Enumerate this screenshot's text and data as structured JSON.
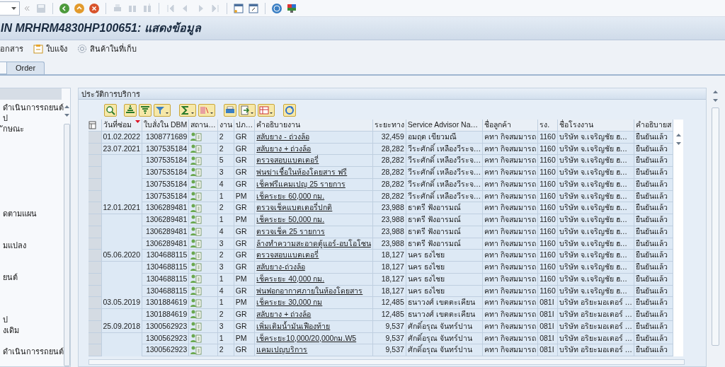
{
  "title": "IN MRHRM4830HP100651: แสดงข้อมูล",
  "app_toolbar": [
    {
      "label": "อกสาร",
      "kind": "plain"
    },
    {
      "label": "ใบแจ้ง",
      "kind": "notice"
    },
    {
      "label": "สินค้าในที่เก็บ",
      "kind": "stock"
    }
  ],
  "tabs": [
    {
      "label": "Order",
      "selected": false
    }
  ],
  "sidebar": {
    "items": [
      {
        "label": "ดำเนินการรถยนต์"
      },
      {
        "label": "ป"
      },
      {
        "label": "ักษณะ"
      },
      {
        "label": "ดตามแผน"
      },
      {
        "label": "มแปลง"
      },
      {
        "label": "ยนต์"
      },
      {
        "label": "ป"
      },
      {
        "label": "งเดิม"
      },
      {
        "label": "ดำเนินการรถยนต์"
      }
    ]
  },
  "panel": {
    "title": "ประวัติการบริการ",
    "table": {
      "columns": [
        "วันที่ซ่อม",
        "ใบสั่งใน DBM",
        "สถาน…",
        "งาน",
        "ปภ…",
        "คำอธิบายงาน",
        "ระยะทาง",
        "Service Advisor Na…",
        "ชื่อลูกค้า",
        "รง.",
        "ชื่อโรงงาน",
        "คำอธิบายส"
      ],
      "rows": [
        {
          "date": "01.02.2022",
          "order": "1308771689",
          "task": "2",
          "type": "GR",
          "description": "สลับยาง - ถ่วงล้อ",
          "distance": "32,459",
          "advisor": "อมฤต เขียวมณี",
          "customer": "คทา กิจสมมารถ",
          "plant": "1160",
          "plant_name": "บริษัท จ.เจริญชัย ฮ…",
          "state": "ยืนยันแล้ว"
        },
        {
          "date": "23.07.2021",
          "order": "1307535184",
          "task": "2",
          "type": "GR",
          "description": "สลับยาง + ถ่วงล้อ",
          "distance": "28,282",
          "advisor": "วีระศักดิ์ เหลืองวีระจ…",
          "customer": "คทา กิจสมมารถ",
          "plant": "1160",
          "plant_name": "บริษัท จ.เจริญชัย ฮ…",
          "state": "ยืนยันแล้ว"
        },
        {
          "order": "1307535184",
          "task": "5",
          "type": "GR",
          "description": "ตรวจสอบแบตเตอรี่",
          "distance": "28,282",
          "advisor": "วีระศักดิ์ เหลืองวีระจ…",
          "customer": "คทา กิจสมมารถ",
          "plant": "1160",
          "plant_name": "บริษัท จ.เจริญชัย ฮ…",
          "state": "ยืนยันแล้ว"
        },
        {
          "order": "1307535184",
          "task": "3",
          "type": "GR",
          "description": "พ่นฆ่าเชื้อในห้องโดยสาร ฟรี",
          "distance": "28,282",
          "advisor": "วีระศักดิ์ เหลืองวีระจ…",
          "customer": "คทา กิจสมมารถ",
          "plant": "1160",
          "plant_name": "บริษัท จ.เจริญชัย ฮ…",
          "state": "ยืนยันแล้ว"
        },
        {
          "order": "1307535184",
          "task": "4",
          "type": "GR",
          "description": "เช็คฟรีแคมเปญ 25 รายการ",
          "distance": "28,282",
          "advisor": "วีระศักดิ์ เหลืองวีระจ…",
          "customer": "คทา กิจสมมารถ",
          "plant": "1160",
          "plant_name": "บริษัท จ.เจริญชัย ฮ…",
          "state": "ยืนยันแล้ว"
        },
        {
          "order": "1307535184",
          "task": "1",
          "type": "PM",
          "description": "เช็คระยะ 60,000 กม.",
          "distance": "28,282",
          "advisor": "วีระศักดิ์ เหลืองวีระจ…",
          "customer": "คทา กิจสมมารถ",
          "plant": "1160",
          "plant_name": "บริษัท จ.เจริญชัย ฮ…",
          "state": "ยืนยันแล้ว"
        },
        {
          "date": "12.01.2021",
          "order": "1306289481",
          "task": "2",
          "type": "GR",
          "description": "ตรวจเช็คแบตเตอรี่ปกติ",
          "distance": "23,988",
          "advisor": "ธาตรี ฟังอารมณ์",
          "customer": "คทา กิจสมมารถ",
          "plant": "1160",
          "plant_name": "บริษัท จ.เจริญชัย ฮ…",
          "state": "ยืนยันแล้ว"
        },
        {
          "order": "1306289481",
          "task": "1",
          "type": "PM",
          "description": "เช็คระยะ 50,000 กม.",
          "distance": "23,988",
          "advisor": "ธาตรี ฟังอารมณ์",
          "customer": "คทา กิจสมมารถ",
          "plant": "1160",
          "plant_name": "บริษัท จ.เจริญชัย ฮ…",
          "state": "ยืนยันแล้ว"
        },
        {
          "order": "1306289481",
          "task": "4",
          "type": "GR",
          "description": "ตรวจเช็ค 25 รายการ",
          "distance": "23,988",
          "advisor": "ธาตรี ฟังอารมณ์",
          "customer": "คทา กิจสมมารถ",
          "plant": "1160",
          "plant_name": "บริษัท จ.เจริญชัย ฮ…",
          "state": "ยืนยันแล้ว"
        },
        {
          "order": "1306289481",
          "task": "3",
          "type": "GR",
          "description": "ล้างทำความสะอาดตู้แอร์-อบโอโซน",
          "distance": "23,988",
          "advisor": "ธาตรี ฟังอารมณ์",
          "customer": "คทา กิจสมมารถ",
          "plant": "1160",
          "plant_name": "บริษัท จ.เจริญชัย ฮ…",
          "state": "ยืนยันแล้ว"
        },
        {
          "date": "05.06.2020",
          "order": "1304688115",
          "task": "2",
          "type": "GR",
          "description": "ตรวจสอบแบตเตอรี่",
          "distance": "18,127",
          "advisor": "นคร ธงไชย",
          "customer": "คทา กิจสมมารถ",
          "plant": "1160",
          "plant_name": "บริษัท จ.เจริญชัย ฮ…",
          "state": "ยืนยันแล้ว"
        },
        {
          "order": "1304688115",
          "task": "3",
          "type": "GR",
          "description": "สลับยาง-ถ่วงล้อ",
          "distance": "18,127",
          "advisor": "นคร ธงไชย",
          "customer": "คทา กิจสมมารถ",
          "plant": "1160",
          "plant_name": "บริษัท จ.เจริญชัย ฮ…",
          "state": "ยืนยันแล้ว"
        },
        {
          "order": "1304688115",
          "task": "1",
          "type": "PM",
          "description": "เช็คระยะ 40,000 กม.",
          "distance": "18,127",
          "advisor": "นคร ธงไชย",
          "customer": "คทา กิจสมมารถ",
          "plant": "1160",
          "plant_name": "บริษัท จ.เจริญชัย ฮ…",
          "state": "ยืนยันแล้ว"
        },
        {
          "order": "1304688115",
          "task": "4",
          "type": "GR",
          "description": "พ่นฟอกอากาศภายในห้องโดยสาร",
          "distance": "18,127",
          "advisor": "นคร ธงไชย",
          "customer": "คทา กิจสมมารถ",
          "plant": "1160",
          "plant_name": "บริษัท จ.เจริญชัย ฮ…",
          "state": "ยืนยันแล้ว"
        },
        {
          "date": "03.05.2019",
          "order": "1301884619",
          "task": "1",
          "type": "PM",
          "description": "เช็คระยะ 30,000 กม",
          "distance": "12,485",
          "advisor": "ธนาวงศ์ เขตตะเคียน",
          "customer": "คทา กิจสมมารถ",
          "plant": "081I",
          "plant_name": "บริษัท อริยะมอเตอร์ …",
          "state": "ยืนยันแล้ว"
        },
        {
          "order": "1301884619",
          "task": "2",
          "type": "GR",
          "description": "สลับยาง + ถ่วงล้อ",
          "distance": "12,485",
          "advisor": "ธนาวงศ์ เขตตะเคียน",
          "customer": "คทา กิจสมมารถ",
          "plant": "081I",
          "plant_name": "บริษัท อริยะมอเตอร์ …",
          "state": "ยืนยันแล้ว"
        },
        {
          "date": "25.09.2018",
          "order": "1300562923",
          "task": "3",
          "type": "GR",
          "description": "เพิ่มเติมน้ำมันเฟืองท้าย",
          "distance": "9,537",
          "advisor": "ศักดิ์อรุณ จันทร์ปาน",
          "customer": "คทา กิจสมมารถ",
          "plant": "081I",
          "plant_name": "บริษัท อริยะมอเตอร์ …",
          "state": "ยืนยันแล้ว"
        },
        {
          "order": "1300562923",
          "task": "1",
          "type": "PM",
          "description": "เช็คระยะ10,000/20,000กม.W5",
          "distance": "9,537",
          "advisor": "ศักดิ์อรุณ จันทร์ปาน",
          "customer": "คทา กิจสมมารถ",
          "plant": "081I",
          "plant_name": "บริษัท อริยะมอเตอร์ …",
          "state": "ยืนยันแล้ว"
        },
        {
          "order": "1300562923",
          "task": "2",
          "type": "GR",
          "description": "แคมเปญบริการ",
          "distance": "9,537",
          "advisor": "ศักดิ์อรุณ จันทร์ปาน",
          "customer": "คทา กิจสมมารถ",
          "plant": "081I",
          "plant_name": "บริษัท อริยะมอเตอร์ …",
          "state": "ยืนยันแล้ว"
        }
      ]
    }
  }
}
